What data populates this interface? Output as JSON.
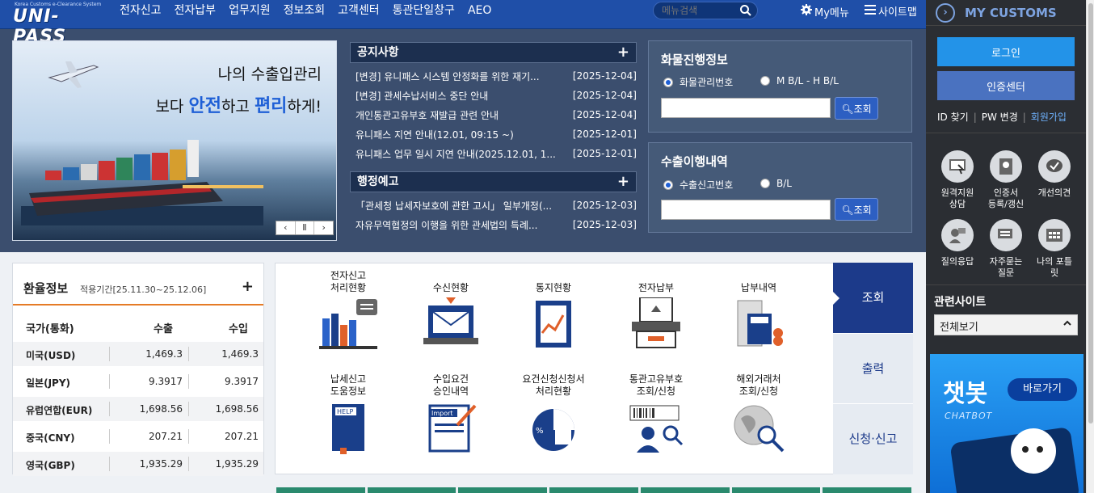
{
  "header": {
    "logo_sub": "Korea Customs e-Clearance System",
    "logo": "UNI-PASS",
    "nav": [
      "전자신고",
      "전자납부",
      "업무지원",
      "정보조회",
      "고객센터",
      "통관단일창구",
      "AEO"
    ],
    "search_placeholder": "메뉴검색",
    "my_menu": "My메뉴",
    "sitemap": "사이트맵"
  },
  "banner": {
    "line1": "나의 수출입관리",
    "line2_pre": "보다 ",
    "line2_b1": "안전",
    "line2_mid": "하고 ",
    "line2_b2": "편리",
    "line2_post": "하게!",
    "controls": [
      "‹",
      "Ⅱ",
      "›"
    ]
  },
  "notice": {
    "title": "공지사항",
    "plus": "+",
    "items": [
      {
        "title": "[변경] 유니패스 시스템 안정화를 위한 재기...",
        "date": "[2025-12-04]"
      },
      {
        "title": "[변경] 관세수납서비스 중단 안내",
        "date": "[2025-12-04]"
      },
      {
        "title": "개인통관고유부호 재발급 관련 안내",
        "date": "[2025-12-04]"
      },
      {
        "title": "유니패스 지연 안내(12.01, 09:15 ~)",
        "date": "[2025-12-01]"
      },
      {
        "title": "유니패스 업무 일시 지연 안내(2025.12.01, 1...",
        "date": "[2025-12-01]"
      }
    ]
  },
  "admin_notice": {
    "title": "행정예고",
    "plus": "+",
    "items": [
      {
        "title": "「관세청 납세자보호에 관한 고시」 일부개정(...",
        "date": "[2025-12-03]"
      },
      {
        "title": "자유무역협정의 이행을 위한 관세법의 특례...",
        "date": "[2025-12-03]"
      }
    ]
  },
  "cargo": {
    "title": "화물진행정보",
    "radio1": "화물관리번호",
    "radio2": "M B/L - H B/L",
    "button": "조회"
  },
  "export": {
    "title": "수출이행내역",
    "radio1": "수출신고번호",
    "radio2": "B/L",
    "button": "조회"
  },
  "exchange": {
    "title": "환율정보",
    "period": "적용기간[25.11.30~25.12.06]",
    "plus": "+",
    "col_country": "국가(통화)",
    "col_export": "수출",
    "col_import": "수입",
    "rows": [
      {
        "country": "미국(USD)",
        "export": "1,469.3",
        "import": "1,469.3"
      },
      {
        "country": "일본(JPY)",
        "export": "9.3917",
        "import": "9.3917"
      },
      {
        "country": "유럽연합(EUR)",
        "export": "1,698.56",
        "import": "1,698.56"
      },
      {
        "country": "중국(CNY)",
        "export": "207.21",
        "import": "207.21"
      },
      {
        "country": "영국(GBP)",
        "export": "1,935.29",
        "import": "1,935.29"
      }
    ]
  },
  "services": [
    {
      "label": "전자신고\n처리현황",
      "icon": "chart-icon"
    },
    {
      "label": "수신현황",
      "icon": "mail-laptop-icon"
    },
    {
      "label": "통지현황",
      "icon": "clipboard-chart-icon"
    },
    {
      "label": "전자납부",
      "icon": "card-payment-icon"
    },
    {
      "label": "납부내역",
      "icon": "receipt-icon"
    },
    {
      "label": "납세신고\n도움정보",
      "icon": "help-book-icon"
    },
    {
      "label": "수입요건\n승인내역",
      "icon": "import-doc-icon"
    },
    {
      "label": "요건신청신청서\n처리현황",
      "icon": "pie-doc-icon"
    },
    {
      "label": "통관고유부호\n조회/신청",
      "icon": "barcode-search-icon"
    },
    {
      "label": "해외거래처\n조회/신청",
      "icon": "globe-search-icon"
    }
  ],
  "tabs": [
    "조회",
    "출력",
    "신청·신고"
  ],
  "right_panel": {
    "title": "MY CUSTOMS",
    "login": "로그인",
    "cert": "인증센터",
    "id_find": "ID 찾기",
    "pw_change": "PW 변경",
    "join": "회원가입",
    "quick": [
      {
        "label": "원격지원\n상담",
        "icon": "remote-support-icon"
      },
      {
        "label": "인증서\n등록/갱신",
        "icon": "certificate-icon"
      },
      {
        "label": "개선의견",
        "icon": "speech-bubble-icon"
      },
      {
        "label": "질의응답",
        "icon": "qna-icon"
      },
      {
        "label": "자주묻는\n질문",
        "icon": "faq-icon"
      },
      {
        "label": "나의 포틀\n릿",
        "icon": "portlet-icon"
      }
    ],
    "related_title": "관련사이트",
    "related_select": "전체보기",
    "chatbot_big": "챗봇",
    "chatbot_go": "바로가기",
    "chatbot_small": "CHATBOT"
  }
}
